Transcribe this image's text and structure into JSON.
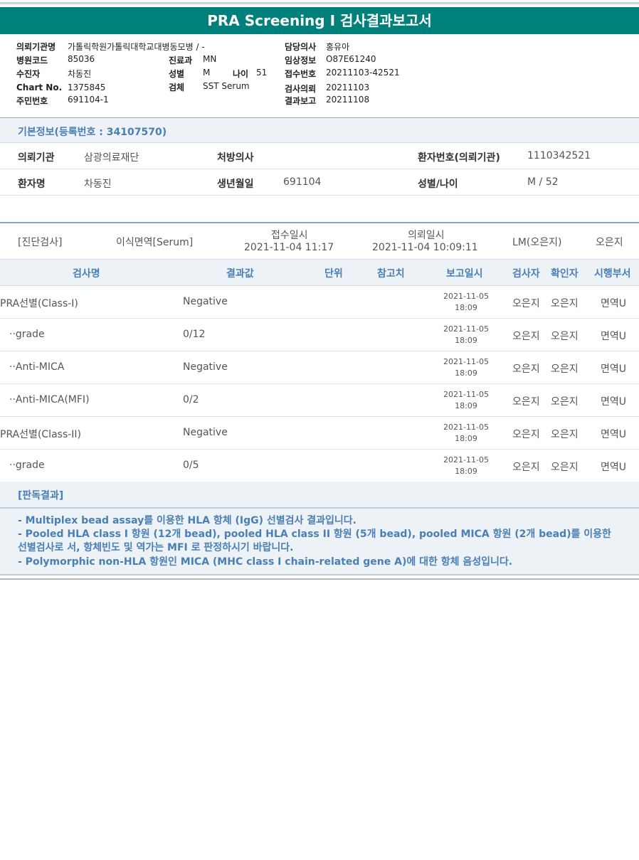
{
  "title": "PRA Screening I 검사결과보고서",
  "header": {
    "labels": {
      "institution": "의뢰기관명",
      "hospital_code": "병원코드",
      "receiver": "수진자",
      "chart_no": "Chart No.",
      "resident_no": "주민번호",
      "department": "진료과",
      "sex": "성별",
      "age": "나이",
      "specimen": "검체",
      "doctor": "담당의사",
      "clinical_info": "임상정보",
      "receipt_no": "접수번호",
      "test_request": "검사의뢰",
      "result_report": "결과보고"
    },
    "values": {
      "institution": "가톨릭학원가톨릭대학교대병동모병 / -",
      "hospital_code": "85036",
      "receiver": "차동진",
      "chart_no": "1375845",
      "resident_no": "691104-1",
      "department": "MN",
      "sex": "M",
      "age": "51",
      "specimen": "SST Serum",
      "doctor": "홍유아",
      "clinical_info": "O87E61240",
      "receipt_no": "20211103-42521",
      "test_request": "20211103",
      "result_report": "20211108"
    }
  },
  "basic_info": {
    "title": "기본정보(등록번호 : 34107570)",
    "row1": {
      "institution_label": "의뢰기관",
      "institution": "삼광의료재단",
      "prescriber_label": "처방의사",
      "prescriber": "",
      "patient_no_label": "환자번호(의뢰기관)",
      "patient_no": "1110342521"
    },
    "row2": {
      "name_label": "환자명",
      "name": "차동진",
      "birth_label": "생년월일",
      "birth": "691104",
      "sex_age_label": "성별/나이",
      "sex_age": "M / 52"
    }
  },
  "diagnosis": {
    "category": "[진단검사]",
    "test": "이식면역[Serum]",
    "receipt_label": "접수일시",
    "receipt_time": "2021-11-04  11:17",
    "request_label": "의뢰일시",
    "request_time": "2021-11-04  10:09:11",
    "lm": "LM(오은지)",
    "person": "오은지"
  },
  "table": {
    "headers": {
      "name": "검사명",
      "result": "결과값",
      "unit": "단위",
      "reference": "참고치",
      "report_time": "보고일시",
      "tester": "검사자",
      "confirmer": "확인자",
      "department": "시행부서"
    },
    "rows": [
      {
        "name": "PRA선별(Class-I)",
        "result": "Negative",
        "date": "2021-11-05",
        "time": "18:09",
        "tester": "오은지",
        "confirmer": "오은지",
        "dept": "면역U"
      },
      {
        "name": "··grade",
        "result": "0/12",
        "date": "2021-11-05",
        "time": "18:09",
        "tester": "오은지",
        "confirmer": "오은지",
        "dept": "면역U"
      },
      {
        "name": "··Anti-MICA",
        "result": "Negative",
        "date": "2021-11-05",
        "time": "18:09",
        "tester": "오은지",
        "confirmer": "오은지",
        "dept": "면역U"
      },
      {
        "name": "··Anti-MICA(MFI)",
        "result": "0/2",
        "date": "2021-11-05",
        "time": "18:09",
        "tester": "오은지",
        "confirmer": "오은지",
        "dept": "면역U"
      },
      {
        "name": "PRA선별(Class-II)",
        "result": "Negative",
        "date": "2021-11-05",
        "time": "18:09",
        "tester": "오은지",
        "confirmer": "오은지",
        "dept": "면역U"
      },
      {
        "name": "··grade",
        "result": "0/5",
        "date": "2021-11-05",
        "time": "18:09",
        "tester": "오은지",
        "confirmer": "오은지",
        "dept": "면역U"
      }
    ]
  },
  "interpretation": {
    "title": "[판독결과]",
    "line1": "- Multiplex bead assay를 이용한 HLA 항체 (IgG) 선별검사 결과입니다.",
    "line2": "- Pooled HLA class I 항원 (12개 bead), pooled HLA class II 항원 (5개 bead), pooled MICA 항원 (2개 bead)를 이용한 선별검사로 서, 항체빈도 및 역가는 MFI 로 판정하시기 바랍니다.",
    "line3": "- Polymorphic non-HLA 항원인 MICA (MHC class I chain-related gene A)에 대한 항체 음성입니다."
  }
}
